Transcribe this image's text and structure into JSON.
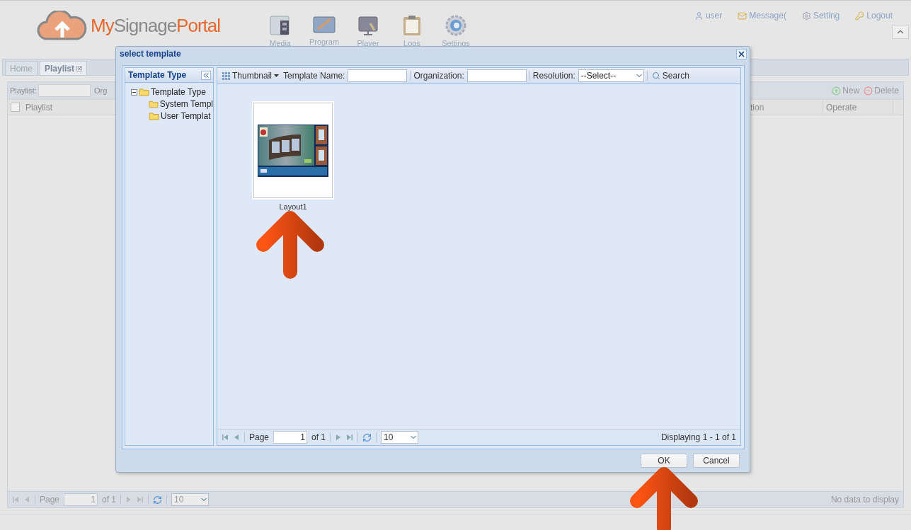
{
  "header": {
    "logo": [
      {
        "text": "My",
        "kind": "accent"
      },
      {
        "text": "Signage",
        "kind": "plain"
      },
      {
        "text": "Portal",
        "kind": "accent"
      }
    ],
    "nav": [
      {
        "label": "Media"
      },
      {
        "label": "Program"
      },
      {
        "label": "Player"
      },
      {
        "label": "Logs"
      },
      {
        "label": "Settings"
      }
    ],
    "user_links": [
      {
        "label": "user"
      },
      {
        "label": "Message("
      },
      {
        "label": "Setting"
      },
      {
        "label": "Logout"
      }
    ]
  },
  "tabs": [
    {
      "label": "Home",
      "selected": false,
      "closable": false
    },
    {
      "label": "Playlist",
      "selected": true,
      "closable": true
    }
  ],
  "toolbar": {
    "field_label": "Playlist:",
    "cut_label": "Org",
    "buttons": [
      {
        "label": "New",
        "kind": "add"
      },
      {
        "label": "Delete",
        "kind": "remove"
      }
    ]
  },
  "table": {
    "columns": [
      {
        "label": "Playlist",
        "kind": "check",
        "checked": false
      },
      {
        "label": "tion",
        "kind": "plain"
      },
      {
        "label": "Operate",
        "kind": "plain"
      }
    ],
    "pager": {
      "page_label": "Page",
      "page": "1",
      "of": "of 1",
      "page_size": "10",
      "status": "No data to display"
    }
  },
  "dialog": {
    "title": "select template",
    "tree": {
      "title": "Template Type",
      "root": {
        "label": "Template Type",
        "expanded": true,
        "children": [
          {
            "label": "System Templ"
          },
          {
            "label": "User Templat"
          }
        ]
      }
    },
    "toolbar": {
      "view": "Thumbnail",
      "name_label": "Template Name:",
      "org_label": "Organization:",
      "res_label": "Resolution:",
      "res_value": "--Select--",
      "search": "Search"
    },
    "templates": [
      {
        "name": "Layout1",
        "kind": "picture"
      }
    ],
    "pager": {
      "page_label": "Page",
      "page": "1",
      "of": "of 1",
      "page_size": "10",
      "status": "Displaying 1 - 1 of 1"
    },
    "buttons": [
      {
        "label": "OK"
      },
      {
        "label": "Cancel"
      }
    ]
  },
  "annotations": [
    {
      "kind": "arrow"
    },
    {
      "kind": "arrow"
    }
  ]
}
